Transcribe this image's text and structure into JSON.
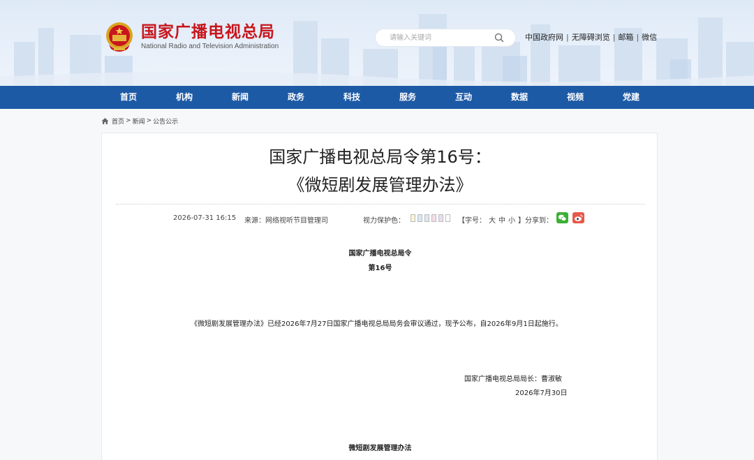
{
  "header": {
    "logo_cn": "国家广播电视总局",
    "logo_en": "National Radio and Television Administration",
    "search_placeholder": "请输入关键词",
    "links": [
      "中国政府网",
      "无障碍浏览",
      "邮箱",
      "微信"
    ],
    "separator": "|"
  },
  "nav": {
    "items": [
      "首页",
      "机构",
      "新闻",
      "政务",
      "科技",
      "服务",
      "互动",
      "数据",
      "视频",
      "党建"
    ]
  },
  "breadcrumb": {
    "items": [
      "首页",
      "新闻",
      "公告公示"
    ],
    "arrow": ">"
  },
  "article": {
    "title_line1": "国家广播电视总局令第16号：",
    "title_line2": "《微短剧发展管理办法》",
    "date": "2026-07-31 16:15",
    "source": "来源：网络视听节目管理司",
    "eye_label": "视力保护色：",
    "eye_colors": [
      "#fbf3d4",
      "#d6e8f5",
      "#dfe6ee",
      "#f5dde6",
      "#e6dff2",
      "#ffffff"
    ],
    "font_label_open": "【字号：",
    "font_sizes": [
      "大",
      "中",
      "小"
    ],
    "font_label_close": "】",
    "share_label": "分享到：",
    "order_title": "国家广播电视总局令",
    "order_number": "第16号",
    "paragraph": "《微短剧发展管理办法》已经2026年7月27日国家广播电视总局局务会审议通过，现予公布，自2026年9月1日起施行。",
    "signer": "国家广播电视总局局长：曹淑敏",
    "sign_date": "2026年7月30日",
    "section_title": "微短剧发展管理办法"
  },
  "colors": {
    "nav_bg": "#1d5aa6",
    "logo_red": "#c8161d",
    "wechat": "#3cb035",
    "weibo": "#e6584b"
  }
}
